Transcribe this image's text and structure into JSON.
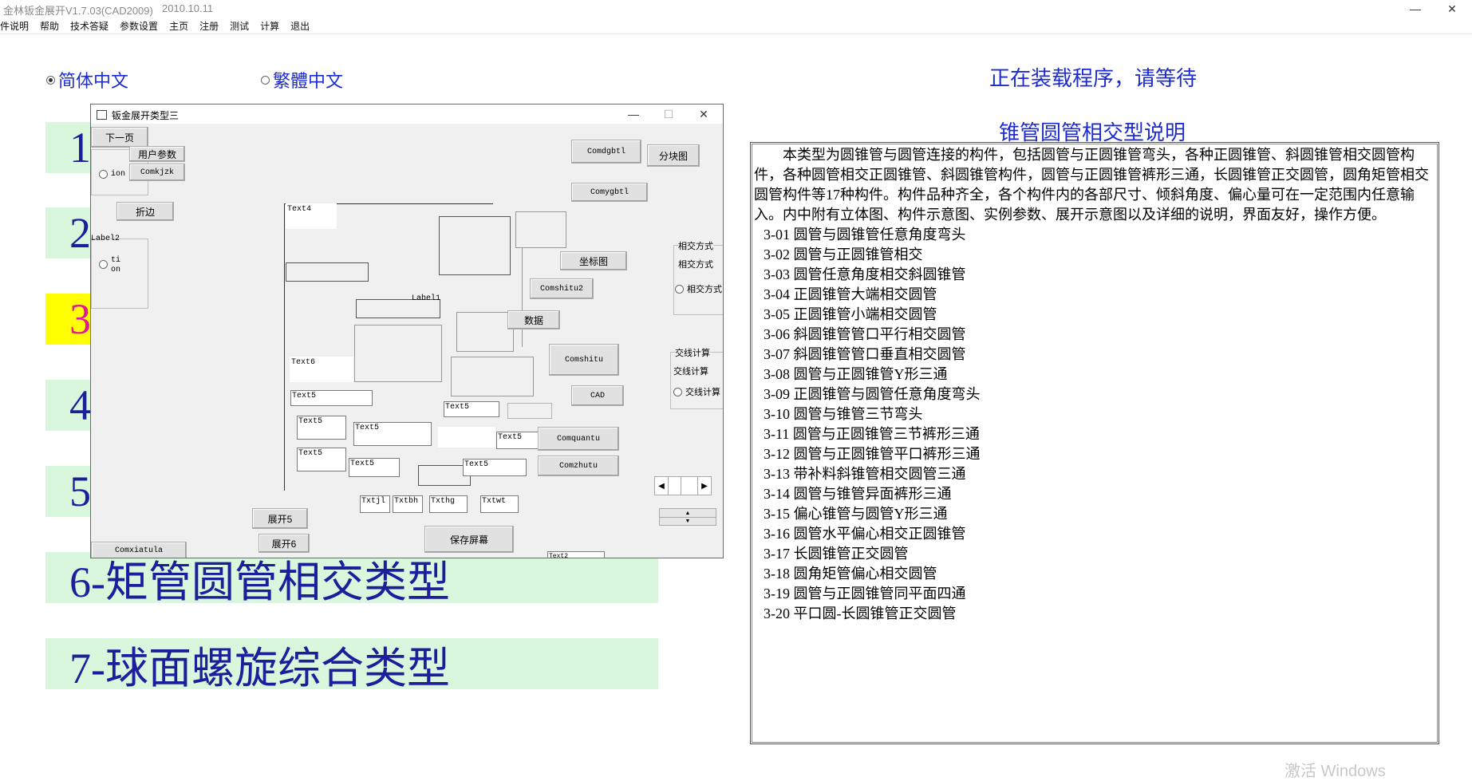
{
  "window": {
    "title": "金林钣金展开V1.7.03(CAD2009)",
    "date": "2010.10.11",
    "minimize": "—",
    "maximize": "☐",
    "close": "✕"
  },
  "menu": [
    "件说明",
    "帮助",
    "技术答疑",
    "参数设置",
    "主页",
    "注册",
    "测试",
    "计算",
    "退出"
  ],
  "language": {
    "simplified": "简体中文",
    "traditional": "繁體中文",
    "selected": "simplified"
  },
  "categories": [
    {
      "label": "1",
      "active": false
    },
    {
      "label": "2",
      "active": false
    },
    {
      "label": "3",
      "active": true
    },
    {
      "label": "4",
      "active": false
    },
    {
      "label": "5",
      "active": false
    },
    {
      "label": "6-矩管圆管相交类型",
      "active": false
    },
    {
      "label": "7-球面螺旋综合类型",
      "active": false
    }
  ],
  "loading_text": "正在装载程序，请等待",
  "description": {
    "title": "锥管圆管相交型说明",
    "paragraph": "本类型为圆锥管与圆管连接的构件，包括圆管与正圆锥管弯头，各种正圆锥管、斜圆锥管相交圆管构件，各种圆管相交正圆锥管、斜圆锥管构件，圆管与正圆锥管裤形三通，长圆锥管正交圆管，圆角矩管相交圆管构件等17种构件。构件品种齐全，各个构件内的各部尺寸、倾斜角度、偏心量可在一定范围内任意输入。内中附有立体图、构件示意图、实例参数、展开示意图以及详细的说明，界面友好，操作方便。",
    "items": [
      "3-01  圆管与圆锥管任意角度弯头",
      "3-02  圆管与正圆锥管相交",
      "3-03  圆管任意角度相交斜圆锥管",
      "3-04  正圆锥管大端相交圆管",
      "3-05  正圆锥管小端相交圆管",
      "3-06  斜圆锥管管口平行相交圆管",
      "3-07  斜圆锥管管口垂直相交圆管",
      "3-08  圆管与正圆锥管Y形三通",
      "3-09  正圆锥管与圆管任意角度弯头",
      "3-10  圆管与锥管三节弯头",
      "3-11  圆管与正圆锥管三节裤形三通",
      "3-12  圆管与正圆锥管平口裤形三通",
      "3-13  带补料斜锥管相交圆管三通",
      "3-14  圆管与锥管异面裤形三通",
      "3-15  偏心锥管与圆管Y形三通",
      "3-16  圆管水平偏心相交正圆锥管",
      "3-17  长圆锥管正交圆管",
      "3-18  圆角矩管偏心相交圆管",
      "3-19  圆管与正圆锥管同平面四通",
      "3-20  平口圆-长圆锥管正交圆管"
    ]
  },
  "watermark": "激活 Windows",
  "dialog": {
    "title": "钣金展开类型三",
    "buttons": {
      "next": "下一页",
      "user_params": "用户参数",
      "comkjzk": "Comkjzk",
      "fold": "折边",
      "comdgbtl": "Comdgbtl",
      "split": "分块图",
      "comygbtl": "Comygbtl",
      "coord": "坐标图",
      "comshitu2": "Comshitu2",
      "data": "数据",
      "comshitu": "Comshitu",
      "cad": "CAD",
      "comquantu": "Comquantu",
      "comzhutu": "Comzhutu",
      "zhankai5": "展开5",
      "zhankai6": "展开6",
      "save_screen": "保存屏幕",
      "comxiatula": "Comxiatula"
    },
    "labels": {
      "label2": "Label2",
      "label1": "Label1",
      "radio1": "ion",
      "radio2a": "ti",
      "radio2b": "on",
      "group_intersect_title": "相交方式",
      "group_intersect_label": "相交方式",
      "group_intersect_radio": "相交方式",
      "group_calc_title": "交线计算",
      "group_calc_label": "交线计算",
      "group_calc_radio": "交线计算"
    },
    "textboxes": {
      "text4": "Text4",
      "text6": "Text6",
      "text5": "Text5",
      "txtjl": "Txtjl",
      "txtbh": "Txtbh",
      "txthg": "Txthg",
      "txtwt": "Txtwt",
      "text_partial": "Text2"
    }
  }
}
